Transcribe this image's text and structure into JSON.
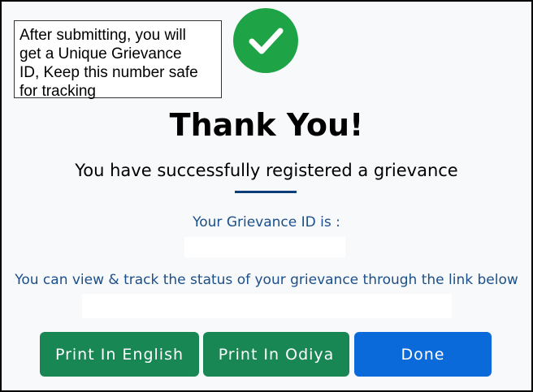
{
  "note": {
    "text": "After submitting, you will\nget a Unique Grievance\nID, Keep this number safe\nfor tracking"
  },
  "success_icon": "check-circle-icon",
  "heading": "Thank You!",
  "subheading": "You have successfully registered a grievance",
  "grievance": {
    "id_label": "Your Grievance ID is :",
    "id_value": ""
  },
  "tracking": {
    "text": "You can view & track the status of your grievance through the link below",
    "link": ""
  },
  "buttons": {
    "print_english": "Print In English",
    "print_odiya": "Print In Odiya",
    "done": "Done"
  },
  "colors": {
    "success": "#1ea446",
    "print_button": "#198754",
    "done_button": "#0b6ad9",
    "accent_text": "#1b4f8a"
  }
}
